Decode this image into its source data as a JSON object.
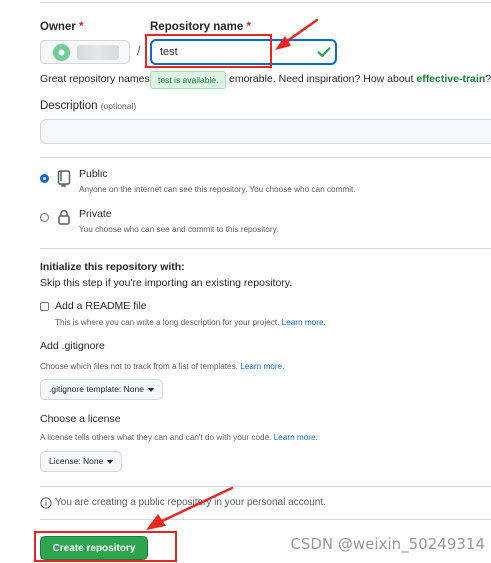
{
  "owner": {
    "label": "Owner",
    "required_mark": "*"
  },
  "repo": {
    "label": "Repository name",
    "required_mark": "*",
    "value": "test",
    "slash": "/",
    "availability_tooltip": "test is available."
  },
  "suggestion": {
    "prefix": "Great repository names",
    "middle": "emorable. Need inspiration? How about",
    "suggested_name": "effective-train",
    "suffix": "?"
  },
  "description": {
    "label": "Description",
    "optional": "(optional)",
    "value": ""
  },
  "visibility": {
    "public": {
      "title": "Public",
      "desc": "Anyone on the internet can see this repository. You choose who can commit.",
      "selected": true
    },
    "private": {
      "title": "Private",
      "desc": "You choose who can see and commit to this repository.",
      "selected": false
    }
  },
  "initialize": {
    "title": "Initialize this repository with:",
    "subtitle": "Skip this step if you're importing an existing repository.",
    "readme": {
      "label": "Add a README file",
      "desc": "This is where you can write a long description for your project.",
      "link": "Learn more.",
      "checked": false
    },
    "gitignore": {
      "title": "Add .gitignore",
      "desc": "Choose which files not to track from a list of templates.",
      "link": "Learn more.",
      "select_label": ".gitignore template: None"
    },
    "license": {
      "title": "Choose a license",
      "desc": "A license tells others what they can and can't do with your code.",
      "link": "Learn more.",
      "select_label": "License: None"
    }
  },
  "notice": "You are creating a public repository in your personal account.",
  "create_button": "Create repository",
  "watermark": "CSDN @weixin_50249314",
  "colors": {
    "annotation": "#e8261f",
    "primary_button": "#2da44e",
    "link": "#0969da",
    "suggestion": "#1a7f37"
  },
  "icons": {
    "check": "check-icon",
    "repo": "repo-icon",
    "lock": "lock-icon",
    "info": "info-icon",
    "arrow": "red-arrow-annotation"
  }
}
